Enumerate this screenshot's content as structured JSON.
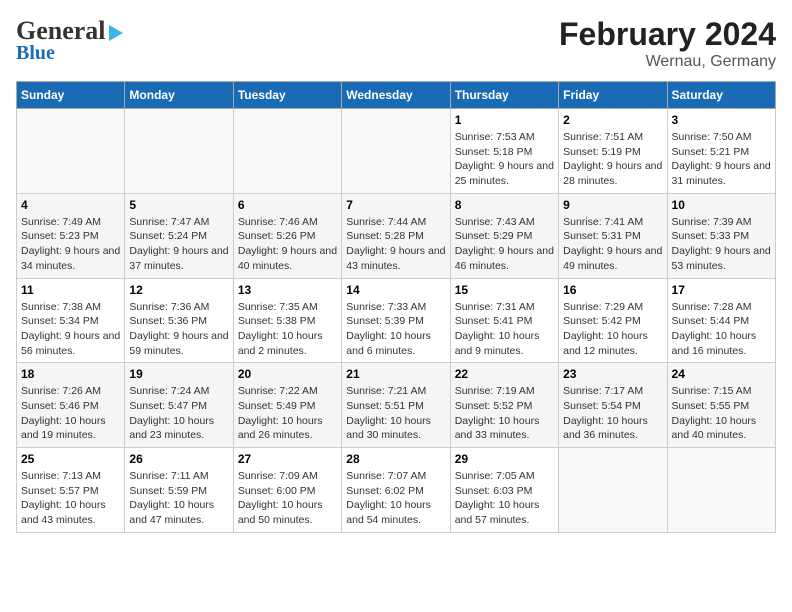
{
  "header": {
    "logo_general": "General",
    "logo_blue": "Blue",
    "title": "February 2024",
    "subtitle": "Wernau, Germany"
  },
  "calendar": {
    "days_of_week": [
      "Sunday",
      "Monday",
      "Tuesday",
      "Wednesday",
      "Thursday",
      "Friday",
      "Saturday"
    ],
    "weeks": [
      [
        {
          "date": "",
          "info": ""
        },
        {
          "date": "",
          "info": ""
        },
        {
          "date": "",
          "info": ""
        },
        {
          "date": "",
          "info": ""
        },
        {
          "date": "1",
          "info": "Sunrise: 7:53 AM\nSunset: 5:18 PM\nDaylight: 9 hours and 25 minutes."
        },
        {
          "date": "2",
          "info": "Sunrise: 7:51 AM\nSunset: 5:19 PM\nDaylight: 9 hours and 28 minutes."
        },
        {
          "date": "3",
          "info": "Sunrise: 7:50 AM\nSunset: 5:21 PM\nDaylight: 9 hours and 31 minutes."
        }
      ],
      [
        {
          "date": "4",
          "info": "Sunrise: 7:49 AM\nSunset: 5:23 PM\nDaylight: 9 hours and 34 minutes."
        },
        {
          "date": "5",
          "info": "Sunrise: 7:47 AM\nSunset: 5:24 PM\nDaylight: 9 hours and 37 minutes."
        },
        {
          "date": "6",
          "info": "Sunrise: 7:46 AM\nSunset: 5:26 PM\nDaylight: 9 hours and 40 minutes."
        },
        {
          "date": "7",
          "info": "Sunrise: 7:44 AM\nSunset: 5:28 PM\nDaylight: 9 hours and 43 minutes."
        },
        {
          "date": "8",
          "info": "Sunrise: 7:43 AM\nSunset: 5:29 PM\nDaylight: 9 hours and 46 minutes."
        },
        {
          "date": "9",
          "info": "Sunrise: 7:41 AM\nSunset: 5:31 PM\nDaylight: 9 hours and 49 minutes."
        },
        {
          "date": "10",
          "info": "Sunrise: 7:39 AM\nSunset: 5:33 PM\nDaylight: 9 hours and 53 minutes."
        }
      ],
      [
        {
          "date": "11",
          "info": "Sunrise: 7:38 AM\nSunset: 5:34 PM\nDaylight: 9 hours and 56 minutes."
        },
        {
          "date": "12",
          "info": "Sunrise: 7:36 AM\nSunset: 5:36 PM\nDaylight: 9 hours and 59 minutes."
        },
        {
          "date": "13",
          "info": "Sunrise: 7:35 AM\nSunset: 5:38 PM\nDaylight: 10 hours and 2 minutes."
        },
        {
          "date": "14",
          "info": "Sunrise: 7:33 AM\nSunset: 5:39 PM\nDaylight: 10 hours and 6 minutes."
        },
        {
          "date": "15",
          "info": "Sunrise: 7:31 AM\nSunset: 5:41 PM\nDaylight: 10 hours and 9 minutes."
        },
        {
          "date": "16",
          "info": "Sunrise: 7:29 AM\nSunset: 5:42 PM\nDaylight: 10 hours and 12 minutes."
        },
        {
          "date": "17",
          "info": "Sunrise: 7:28 AM\nSunset: 5:44 PM\nDaylight: 10 hours and 16 minutes."
        }
      ],
      [
        {
          "date": "18",
          "info": "Sunrise: 7:26 AM\nSunset: 5:46 PM\nDaylight: 10 hours and 19 minutes."
        },
        {
          "date": "19",
          "info": "Sunrise: 7:24 AM\nSunset: 5:47 PM\nDaylight: 10 hours and 23 minutes."
        },
        {
          "date": "20",
          "info": "Sunrise: 7:22 AM\nSunset: 5:49 PM\nDaylight: 10 hours and 26 minutes."
        },
        {
          "date": "21",
          "info": "Sunrise: 7:21 AM\nSunset: 5:51 PM\nDaylight: 10 hours and 30 minutes."
        },
        {
          "date": "22",
          "info": "Sunrise: 7:19 AM\nSunset: 5:52 PM\nDaylight: 10 hours and 33 minutes."
        },
        {
          "date": "23",
          "info": "Sunrise: 7:17 AM\nSunset: 5:54 PM\nDaylight: 10 hours and 36 minutes."
        },
        {
          "date": "24",
          "info": "Sunrise: 7:15 AM\nSunset: 5:55 PM\nDaylight: 10 hours and 40 minutes."
        }
      ],
      [
        {
          "date": "25",
          "info": "Sunrise: 7:13 AM\nSunset: 5:57 PM\nDaylight: 10 hours and 43 minutes."
        },
        {
          "date": "26",
          "info": "Sunrise: 7:11 AM\nSunset: 5:59 PM\nDaylight: 10 hours and 47 minutes."
        },
        {
          "date": "27",
          "info": "Sunrise: 7:09 AM\nSunset: 6:00 PM\nDaylight: 10 hours and 50 minutes."
        },
        {
          "date": "28",
          "info": "Sunrise: 7:07 AM\nSunset: 6:02 PM\nDaylight: 10 hours and 54 minutes."
        },
        {
          "date": "29",
          "info": "Sunrise: 7:05 AM\nSunset: 6:03 PM\nDaylight: 10 hours and 57 minutes."
        },
        {
          "date": "",
          "info": ""
        },
        {
          "date": "",
          "info": ""
        }
      ]
    ]
  }
}
